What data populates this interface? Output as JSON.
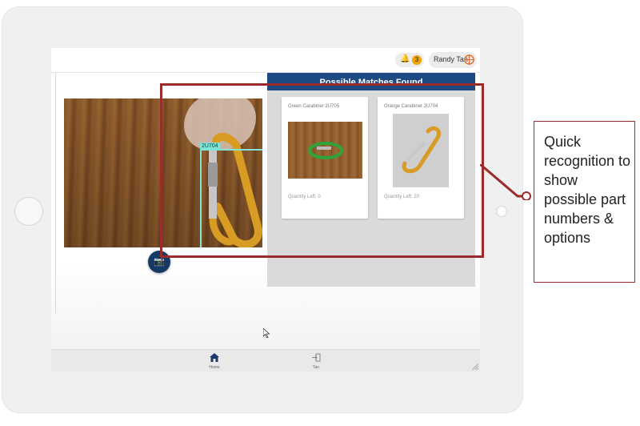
{
  "header": {
    "notification_count": "3",
    "user_name": "Randy Tan"
  },
  "camera": {
    "detection_label": "2U704"
  },
  "matches": {
    "title": "Possible Matches Found",
    "cards": [
      {
        "title": "Green Carabiner 2U705",
        "quantity": "Quantity Left: 0"
      },
      {
        "title": "Orange Carabiner 2U704",
        "quantity": "Quantity Left: 20"
      }
    ]
  },
  "nav": {
    "items": [
      {
        "label": "Home",
        "icon": "home-icon"
      },
      {
        "label": "Tan",
        "icon": "logout-icon"
      }
    ]
  },
  "annotation": {
    "text": "Quick recognition to show possible part numbers & options"
  },
  "colors": {
    "header_blue": "#1e4a84",
    "annotation_red": "#9c2b2b",
    "detection_cyan": "#7fe3d8",
    "badge_orange": "#f0a500"
  }
}
